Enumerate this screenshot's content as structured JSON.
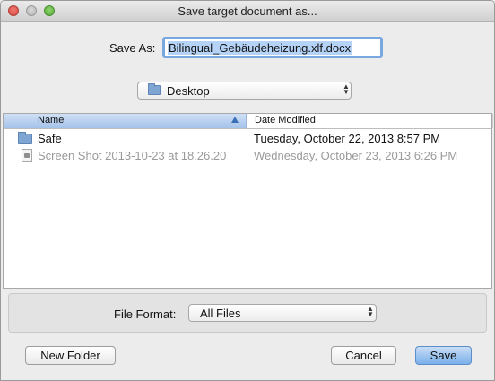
{
  "window": {
    "title": "Save target document as..."
  },
  "save_as": {
    "label": "Save As:",
    "value": "Bilingual_Gebäudeheizung.xlf.docx"
  },
  "location": {
    "selected": "Desktop",
    "icon": "folder-icon"
  },
  "file_list": {
    "columns": [
      "Name",
      "Date Modified"
    ],
    "sort_column": "Name",
    "rows": [
      {
        "name": "Safe",
        "date": "Tuesday, October 22, 2013 8:57 PM",
        "icon": "folder-icon",
        "enabled": true
      },
      {
        "name": "Screen Shot 2013-10-23 at 18.26.20",
        "date": "Wednesday, October 23, 2013 6:26 PM",
        "icon": "image-file-icon",
        "enabled": false
      }
    ]
  },
  "file_format": {
    "label": "File Format:",
    "selected": "All Files"
  },
  "buttons": {
    "new_folder": "New Folder",
    "cancel": "Cancel",
    "save": "Save"
  }
}
